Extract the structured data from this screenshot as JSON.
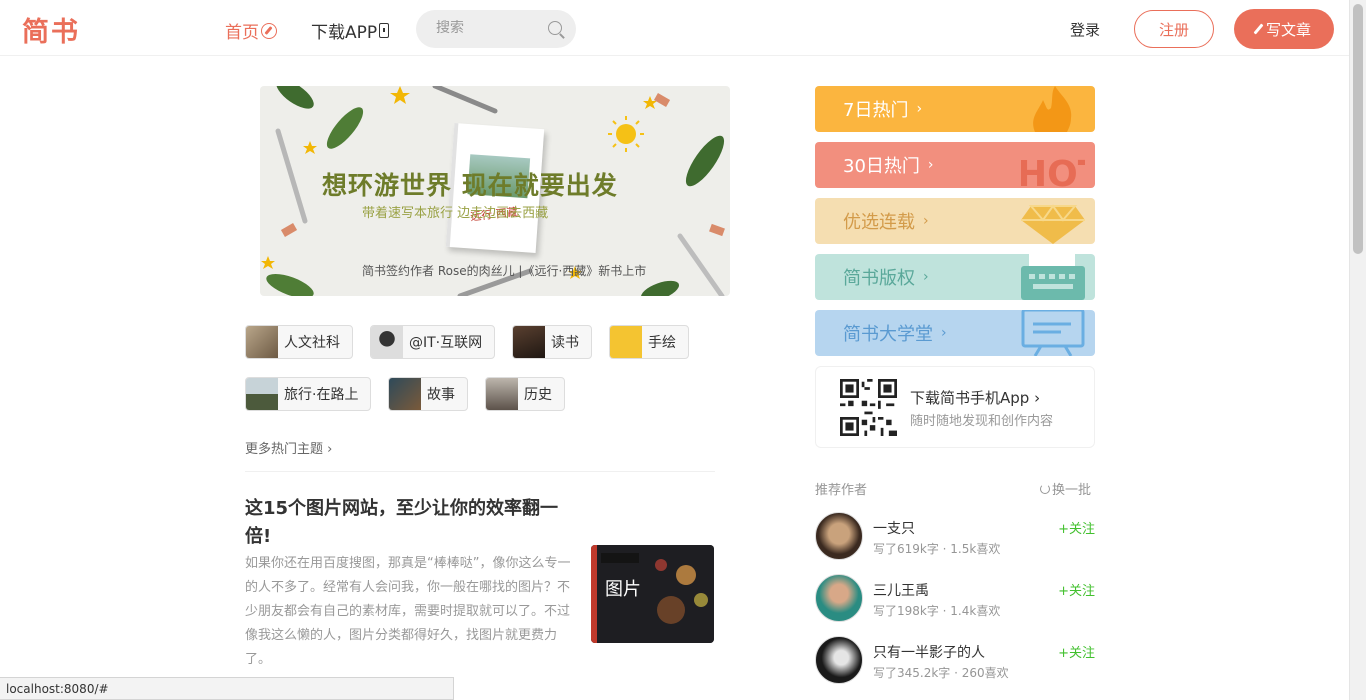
{
  "navbar": {
    "logo": "简书",
    "home": "首页",
    "download": "下载APP",
    "search_placeholder": "搜索",
    "login": "登录",
    "signup": "注册",
    "write": "写文章",
    "accent_color": "#ea6f5a"
  },
  "banner": {
    "title": "想环游世界 现在就要出发",
    "subtitle": "带着速写本旅行 边走边画去西藏",
    "book_title": "远行·西藏",
    "caption": "简书签约作者 Rose的肉丝儿 |《远行·西藏》新书上市"
  },
  "topics": [
    {
      "label": "人文社科",
      "icon": "humanities-thumb"
    },
    {
      "label": "@IT·互联网",
      "icon": "it-thumb"
    },
    {
      "label": "读书",
      "icon": "reading-thumb"
    },
    {
      "label": "手绘",
      "icon": "drawing-thumb"
    },
    {
      "label": "旅行·在路上",
      "icon": "travel-thumb"
    },
    {
      "label": "故事",
      "icon": "story-thumb"
    },
    {
      "label": "历史",
      "icon": "history-thumb"
    }
  ],
  "more_topics": "更多热门主题",
  "article": {
    "title": "这15个图片网站，至少让你的效率翻一倍!",
    "abstract": "如果你还在用百度搜图，那真是“棒棒哒”，像你这么专一的人不多了。经常有人会问我，你一般在哪找的图片？不少朋友都会有自己的素材库，需要时提取就可以了。不过像我这么懒的人，图片分类都得好久，找图片就更费力了。",
    "thumb_text": "图片"
  },
  "boards": [
    {
      "label": "7日热门",
      "color": "#fbb53f",
      "icon": "flame-icon"
    },
    {
      "label": "30日热门",
      "color": "#f28f7e",
      "icon": "hot-icon",
      "deco_text": "HOT"
    },
    {
      "label": "优选连载",
      "color": "#f5deb1",
      "icon": "diamond-icon"
    },
    {
      "label": "简书版权",
      "color": "#bfe3dc",
      "icon": "typewriter-icon"
    },
    {
      "label": "简书大学堂",
      "color": "#b6d5ef",
      "icon": "board-icon"
    }
  ],
  "app_card": {
    "title": "下载简书手机App",
    "subtitle": "随时随地发现和创作内容"
  },
  "recommend": {
    "label": "推荐作者",
    "refresh": "换一批",
    "follow": "+关注",
    "authors": [
      {
        "name": "一支只",
        "stats": "写了619k字 · 1.5k喜欢"
      },
      {
        "name": "三儿王禹",
        "stats": "写了198k字 · 1.4k喜欢"
      },
      {
        "name": "只有一半影子的人",
        "stats": "写了345.2k字 · 260喜欢"
      }
    ]
  },
  "status_bar": {
    "url": "localhost:8080/#"
  }
}
